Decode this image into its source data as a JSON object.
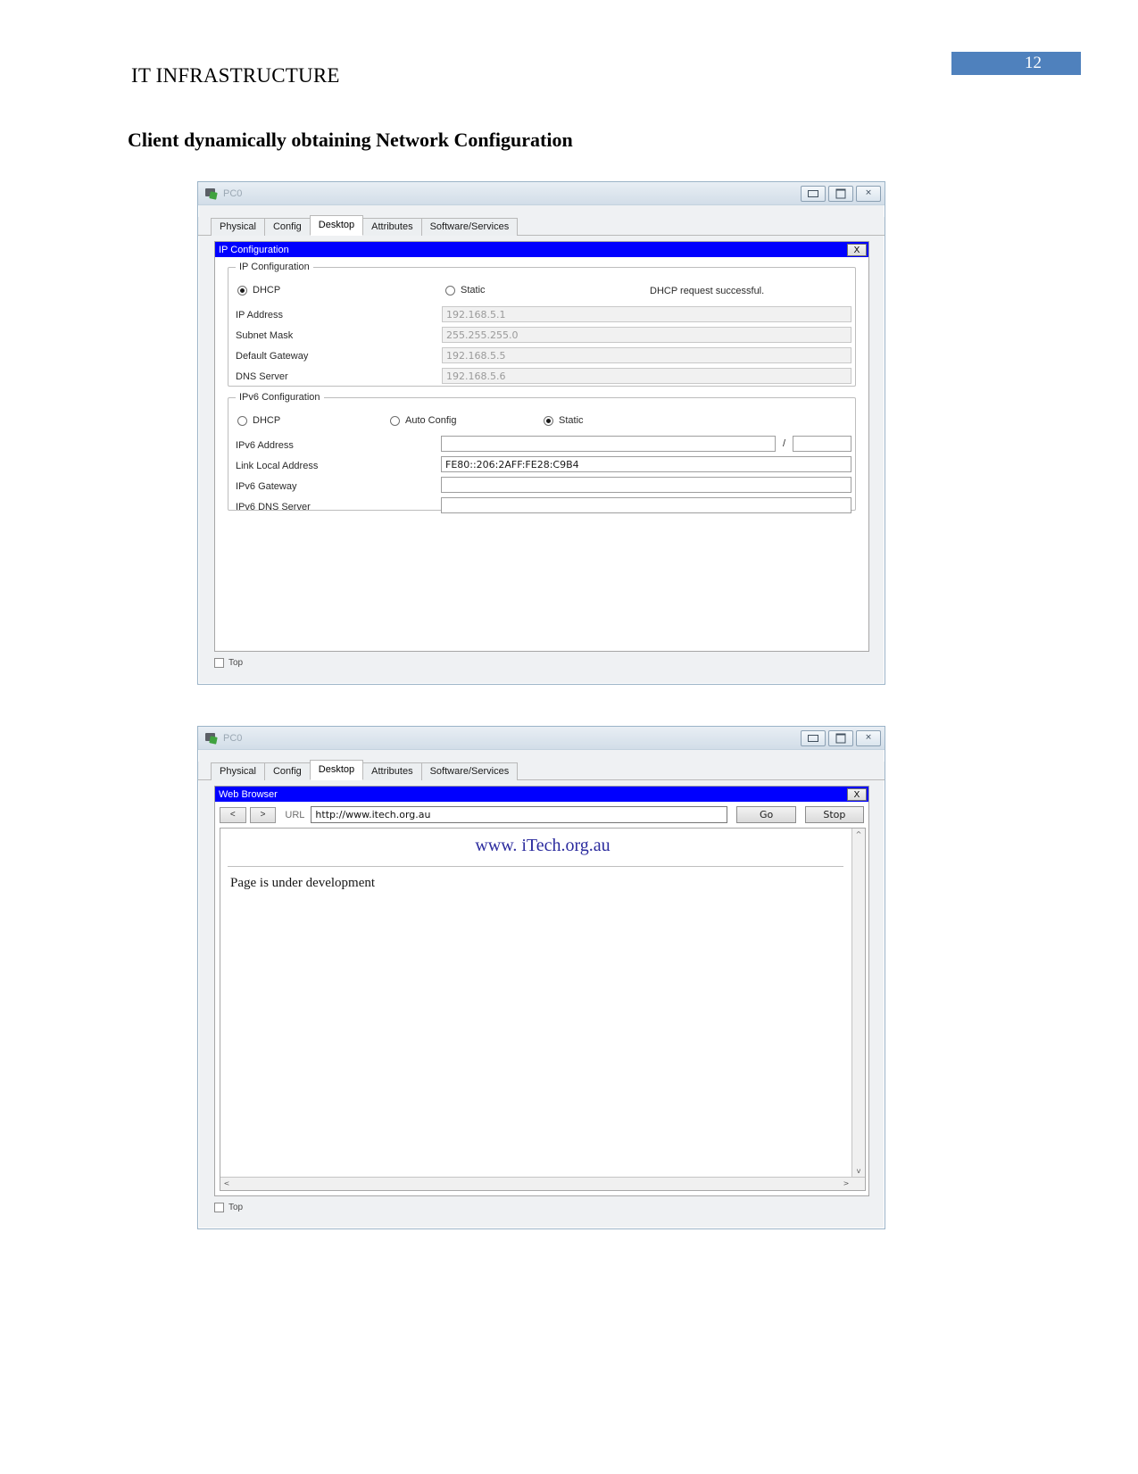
{
  "document": {
    "header_text": "IT INFRASTRUCTURE",
    "page_number": "12",
    "heading": "Client dynamically obtaining Network Configuration",
    "accent_color": "#4f81bd"
  },
  "window1": {
    "title": "PC0",
    "icon": "pc-device-icon",
    "controls": {
      "minimize": "minimize-icon",
      "maximize": "maximize-icon",
      "close": "close-icon"
    },
    "tabs": [
      {
        "label": "Physical",
        "active": false
      },
      {
        "label": "Config",
        "active": false
      },
      {
        "label": "Desktop",
        "active": true
      },
      {
        "label": "Attributes",
        "active": false
      },
      {
        "label": "Software/Services",
        "active": false
      }
    ],
    "app": {
      "title": "IP Configuration",
      "close_label": "X",
      "ipv4_group": {
        "legend": "IP Configuration",
        "mode_dhcp": "DHCP",
        "mode_static": "Static",
        "selected_mode": "DHCP",
        "status": "DHCP request successful.",
        "fields": [
          {
            "label": "IP Address",
            "value": "192.168.5.1"
          },
          {
            "label": "Subnet Mask",
            "value": "255.255.255.0"
          },
          {
            "label": "Default Gateway",
            "value": "192.168.5.5"
          },
          {
            "label": "DNS Server",
            "value": "192.168.5.6"
          }
        ]
      },
      "ipv6_group": {
        "legend": "IPv6 Configuration",
        "mode_dhcp": "DHCP",
        "mode_auto": "Auto Config",
        "mode_static": "Static",
        "selected_mode": "Static",
        "prefix_separator": "/",
        "fields": [
          {
            "label": "IPv6 Address",
            "value": ""
          },
          {
            "label": "Link Local Address",
            "value": "FE80::206:2AFF:FE28:C9B4"
          },
          {
            "label": "IPv6 Gateway",
            "value": ""
          },
          {
            "label": "IPv6 DNS Server",
            "value": ""
          }
        ],
        "prefix_value": ""
      }
    },
    "footer": {
      "top_checkbox_label": "Top",
      "top_checked": false
    }
  },
  "window2": {
    "title": "PC0",
    "icon": "pc-device-icon",
    "controls": {
      "minimize": "minimize-icon",
      "maximize": "maximize-icon",
      "close": "close-icon"
    },
    "tabs": [
      {
        "label": "Physical",
        "active": false
      },
      {
        "label": "Config",
        "active": false
      },
      {
        "label": "Desktop",
        "active": true
      },
      {
        "label": "Attributes",
        "active": false
      },
      {
        "label": "Software/Services",
        "active": false
      }
    ],
    "app": {
      "title": "Web Browser",
      "close_label": "X",
      "toolbar": {
        "back_label": "<",
        "forward_label": ">",
        "url_label": "URL",
        "url_value": "http://www.itech.org.au",
        "go_label": "Go",
        "stop_label": "Stop"
      },
      "page": {
        "site_title": "www. iTech.org.au",
        "body_text": "Page is under development"
      },
      "scrollbar": {
        "up_arrow": "^",
        "down_arrow": "v",
        "left_arrow": "<",
        "right_arrow": ">"
      }
    },
    "footer": {
      "top_checkbox_label": "Top",
      "top_checked": false
    }
  }
}
